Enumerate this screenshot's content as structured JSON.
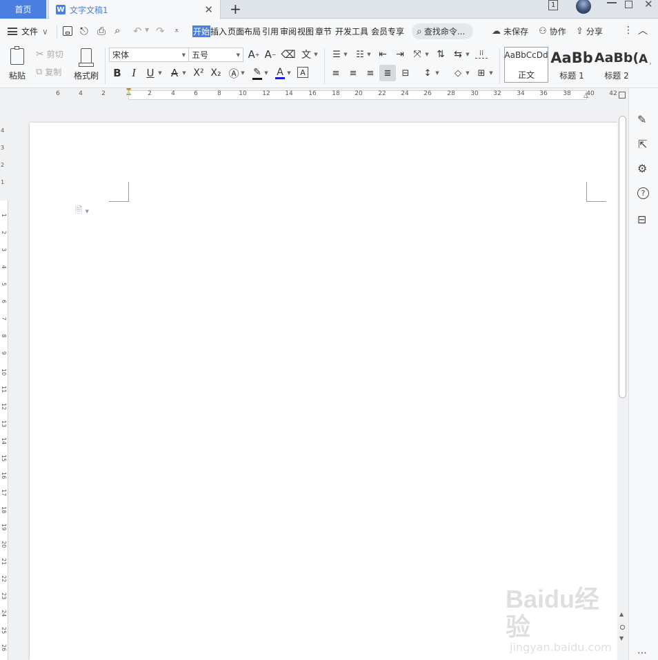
{
  "tabs": {
    "home": "首页",
    "doc_title": "文字文稿1",
    "doc_icon": "W",
    "new_tab": "+"
  },
  "window": {
    "page_indicator": "1"
  },
  "menu": {
    "file": "文件",
    "items": [
      "开始",
      "插入",
      "页面布局",
      "引用",
      "审阅",
      "视图",
      "章节",
      "开发工具",
      "会员专享"
    ],
    "search": "查找命令...",
    "unsaved": "未保存",
    "collaborate": "协作",
    "share": "分享"
  },
  "ribbon": {
    "paste": "粘贴",
    "cut": "剪切",
    "copy": "复制",
    "format_painter": "格式刷",
    "font_name": "宋体",
    "font_size": "五号",
    "bold": "B",
    "italic": "I",
    "underline": "U",
    "strike": "A",
    "superscript": "X²",
    "subscript": "X₂",
    "font_color": "A",
    "char_border": "A",
    "styles": [
      {
        "preview": "AaBbCcDd",
        "label": "正文"
      },
      {
        "preview": "AaBb",
        "label": "标题 1"
      },
      {
        "preview": "AaBb(",
        "label": "标题 2"
      }
    ],
    "style_partial": "A"
  },
  "ruler": {
    "h_labels": [
      "6",
      "4",
      "2",
      "2",
      "4",
      "6",
      "8",
      "10",
      "12",
      "14",
      "16",
      "18",
      "20",
      "22",
      "24",
      "26",
      "28",
      "30",
      "32",
      "34",
      "36",
      "38",
      "40",
      "42"
    ],
    "v_labels_top": [
      "4",
      "3",
      "2",
      "1"
    ],
    "v_labels": [
      "1",
      "2",
      "3",
      "4",
      "5",
      "6",
      "7",
      "8",
      "9",
      "10",
      "11",
      "12",
      "13",
      "14",
      "15",
      "16",
      "17",
      "18",
      "19",
      "20",
      "21",
      "22",
      "23",
      "24",
      "25",
      "26"
    ]
  },
  "watermark": {
    "brand": "Baidu经验",
    "url": "jingyan.baidu.com"
  },
  "colors": {
    "accent": "#4a7fe0",
    "tab_bar": "#dfe3ea",
    "ribbon_bg": "#f7f8fa",
    "font_color_bar": "#1a1ad0",
    "highlight_bar": "#1a1a1a"
  }
}
